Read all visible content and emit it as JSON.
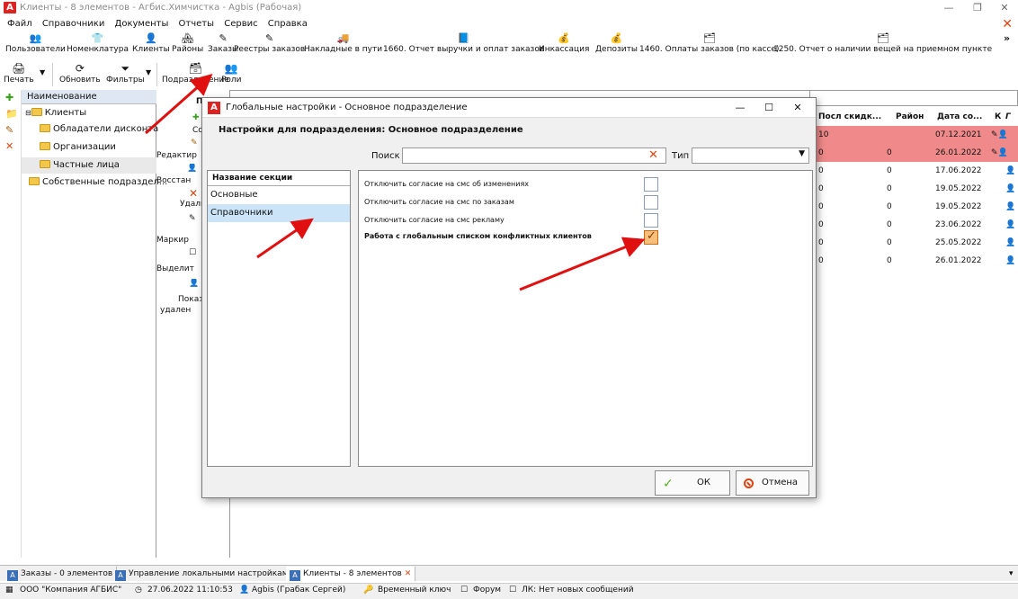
{
  "window": {
    "title": "Клиенты - 8 элементов - Агбис.Химчистка - Agbis (Рабочая)"
  },
  "menu": [
    "Файл",
    "Справочники",
    "Документы",
    "Отчеты",
    "Сервис",
    "Справка"
  ],
  "toolbar1": [
    "Пользователи",
    "Номенклатура",
    "Клиенты",
    "Районы",
    "Заказы",
    "Реестры заказов",
    "Накладные в пути",
    "1660. Отчет выручки и оплат заказов",
    "Инкассация",
    "Депозиты",
    "1460. Оплаты заказов (по кассе)",
    "1250. Отчет о наличии вещей на приемном пункте"
  ],
  "toolbar2": {
    "print": "Печать",
    "refresh": "Обновить",
    "filters": "Фильтры",
    "subdivision": "Подразделение",
    "roles": "Роли"
  },
  "tree": {
    "header": "Наименование",
    "items": [
      {
        "label": "Клиенты"
      },
      {
        "label": "Обладатели дисконта"
      },
      {
        "label": "Организации"
      },
      {
        "label": "Частные лица"
      },
      {
        "label": "Собственные подраздел..."
      }
    ]
  },
  "actions": {
    "search": "Поис",
    "create": "Созда",
    "edit": "Редактир",
    "restore": "Восстан",
    "delete": "Удали",
    "mark": "Маркир",
    "select": "Выделит",
    "show": "Показ",
    "deleted": "удален"
  },
  "grid": {
    "headers": [
      "Посл скидк...",
      "Район",
      "Дата со...",
      "К",
      "Г"
    ],
    "rows": [
      {
        "a": "10",
        "b": "",
        "date": "07.12.2021",
        "highlight": true
      },
      {
        "a": "0",
        "b": "0",
        "date": "26.01.2022",
        "highlight": true
      },
      {
        "a": "0",
        "b": "0",
        "date": "17.06.2022",
        "highlight": false
      },
      {
        "a": "0",
        "b": "0",
        "date": "19.05.2022",
        "highlight": false
      },
      {
        "a": "0",
        "b": "0",
        "date": "19.05.2022",
        "highlight": false
      },
      {
        "a": "0",
        "b": "0",
        "date": "23.06.2022",
        "highlight": false
      },
      {
        "a": "0",
        "b": "0",
        "date": "25.05.2022",
        "highlight": false
      },
      {
        "a": "0",
        "b": "0",
        "date": "26.01.2022",
        "highlight": false
      }
    ]
  },
  "dialog": {
    "title": "Глобальные настройки - Основное подразделение",
    "subheading": "Настройки для подразделения: Основное подразделение",
    "search_label": "Поиск",
    "type_label": "Тип",
    "sections_header": "Название секции",
    "sections": [
      {
        "label": "Основные",
        "selected": false
      },
      {
        "label": "Справочники",
        "selected": true
      }
    ],
    "settings": [
      {
        "label": "Отключить согласие на смс об изменениях",
        "checked": false,
        "bold": false
      },
      {
        "label": "Отключить согласие на смс по заказам",
        "checked": false,
        "bold": false
      },
      {
        "label": "Отключить согласие на смс рекламу",
        "checked": false,
        "bold": false
      },
      {
        "label": "Работа с глобальным списком конфликтных клиентов",
        "checked": true,
        "bold": true
      }
    ],
    "ok": "ОК",
    "cancel": "Отмена"
  },
  "tabs": [
    {
      "label": "Заказы - 0 элементов",
      "active": false
    },
    {
      "label": "Управление локальными настройками",
      "active": false
    },
    {
      "label": "Клиенты - 8 элементов",
      "active": true
    }
  ],
  "status": {
    "company": "ООО \"Компания АГБИС\"",
    "datetime": "27.06.2022 11:10:53",
    "user": "Agbis (Грабак Сергей)",
    "key": "Временный ключ",
    "forum": "Форум",
    "lk": "ЛК: Нет новых сообщений"
  },
  "colors": {
    "accent": "#d22222",
    "selection": "#cce4f7",
    "highlight_row": "#f08a8a",
    "arrow": "#e01010"
  }
}
